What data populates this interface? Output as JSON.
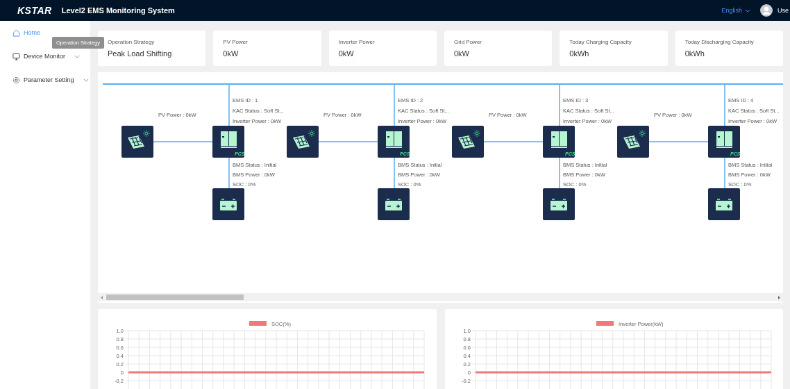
{
  "header": {
    "logo": "KSTAR",
    "title": "Level2 EMS Monitoring System",
    "language": "English",
    "user": "Use"
  },
  "sidebar": {
    "items": [
      {
        "label": "Home",
        "kind": "home",
        "selected": true,
        "expandable": false
      },
      {
        "label": "Device Monitor",
        "kind": "monitor",
        "selected": false,
        "expandable": true
      },
      {
        "label": "Parameter Setting",
        "kind": "settings",
        "selected": false,
        "expandable": true
      }
    ]
  },
  "tooltip": {
    "text": "Operation Strategy"
  },
  "cards": [
    {
      "label": "Operation Strategy",
      "value": "Peak Load Shifting"
    },
    {
      "label": "PV Power",
      "value": "0kW"
    },
    {
      "label": "Inverter Power",
      "value": "0kW"
    },
    {
      "label": "Grid Power",
      "value": "0kW"
    },
    {
      "label": "Today Charging Capacity",
      "value": "0kWh"
    },
    {
      "label": "Today Discharging Capacity",
      "value": "0kWh"
    }
  ],
  "diagram": {
    "units": [
      {
        "ems_id": "EMS ID : 1",
        "kac_status": "KAC Status : Soft St...",
        "inverter_power": "Inverter Power : 0kW",
        "pv_power": "PV Power : 0kW",
        "pcs_label": "PCS",
        "bms_status": "BMS Status : Initial",
        "bms_power": "BMS Power : 0kW",
        "soc": "SOC : 0%"
      },
      {
        "ems_id": "EMS ID : 2",
        "kac_status": "KAC Status : Soft St...",
        "inverter_power": "Inverter Power : 0kW",
        "pv_power": "PV Power : 0kW",
        "pcs_label": "PCS",
        "bms_status": "BMS Status : Initial",
        "bms_power": "BMS Power : 0kW",
        "soc": "SOC : 0%"
      },
      {
        "ems_id": "EMS ID : 3",
        "kac_status": "KAC Status : Soft St...",
        "inverter_power": "Inverter Power : 0kW",
        "pv_power": "PV Power : 0kW",
        "pcs_label": "PCS",
        "bms_status": "BMS Status : Initial",
        "bms_power": "BMS Power : 0kW",
        "soc": "SOC : 0%"
      },
      {
        "ems_id": "EMS ID : 4",
        "kac_status": "KAC Status : Soft St...",
        "inverter_power": "Inverter Power : 0kW",
        "pv_power": "PV Power : 0kW",
        "pcs_label": "PCS",
        "bms_status": "BMS Status : Initial",
        "bms_power": "BMS Power : 0kW",
        "soc": "SOC : 0%"
      }
    ]
  },
  "charts": [
    {
      "chart_data": {
        "type": "line",
        "grid": true,
        "ylim": [
          -0.2,
          1
        ],
        "series": [
          {
            "name": "SOC(%)",
            "color": "#f07878",
            "values": [
              0,
              0,
              0,
              0,
              0,
              0,
              0,
              0,
              0,
              0,
              0,
              0,
              0,
              0,
              0,
              0,
              0,
              0,
              0,
              0,
              0,
              0,
              0,
              0,
              0,
              0,
              0,
              0,
              0
            ]
          }
        ],
        "yticks": [
          {
            "value": 1,
            "label": "1.0"
          },
          {
            "value": 0.8,
            "label": "0.8"
          },
          {
            "value": 0.6,
            "label": "0.6"
          },
          {
            "value": 0.4,
            "label": "0.4"
          },
          {
            "value": 0.2,
            "label": "0.2"
          },
          {
            "value": 0,
            "label": "0"
          },
          {
            "value": -0.2,
            "label": "-0.2"
          }
        ]
      }
    },
    {
      "chart_data": {
        "type": "line",
        "grid": true,
        "ylim": [
          -0.2,
          1
        ],
        "series": [
          {
            "name": "Inverter Power(kW)",
            "color": "#f07878",
            "values": [
              0,
              0,
              0,
              0,
              0,
              0,
              0,
              0,
              0,
              0,
              0,
              0,
              0,
              0,
              0,
              0,
              0,
              0,
              0,
              0,
              0,
              0,
              0,
              0,
              0,
              0,
              0,
              0,
              0
            ]
          }
        ],
        "yticks": [
          {
            "value": 1,
            "label": "1.0"
          },
          {
            "value": 0.8,
            "label": "0.8"
          },
          {
            "value": 0.6,
            "label": "0.6"
          },
          {
            "value": 0.4,
            "label": "0.4"
          },
          {
            "value": 0.2,
            "label": "0.2"
          },
          {
            "value": 0,
            "label": "0"
          },
          {
            "value": -0.2,
            "label": "-0.2"
          }
        ]
      }
    }
  ]
}
